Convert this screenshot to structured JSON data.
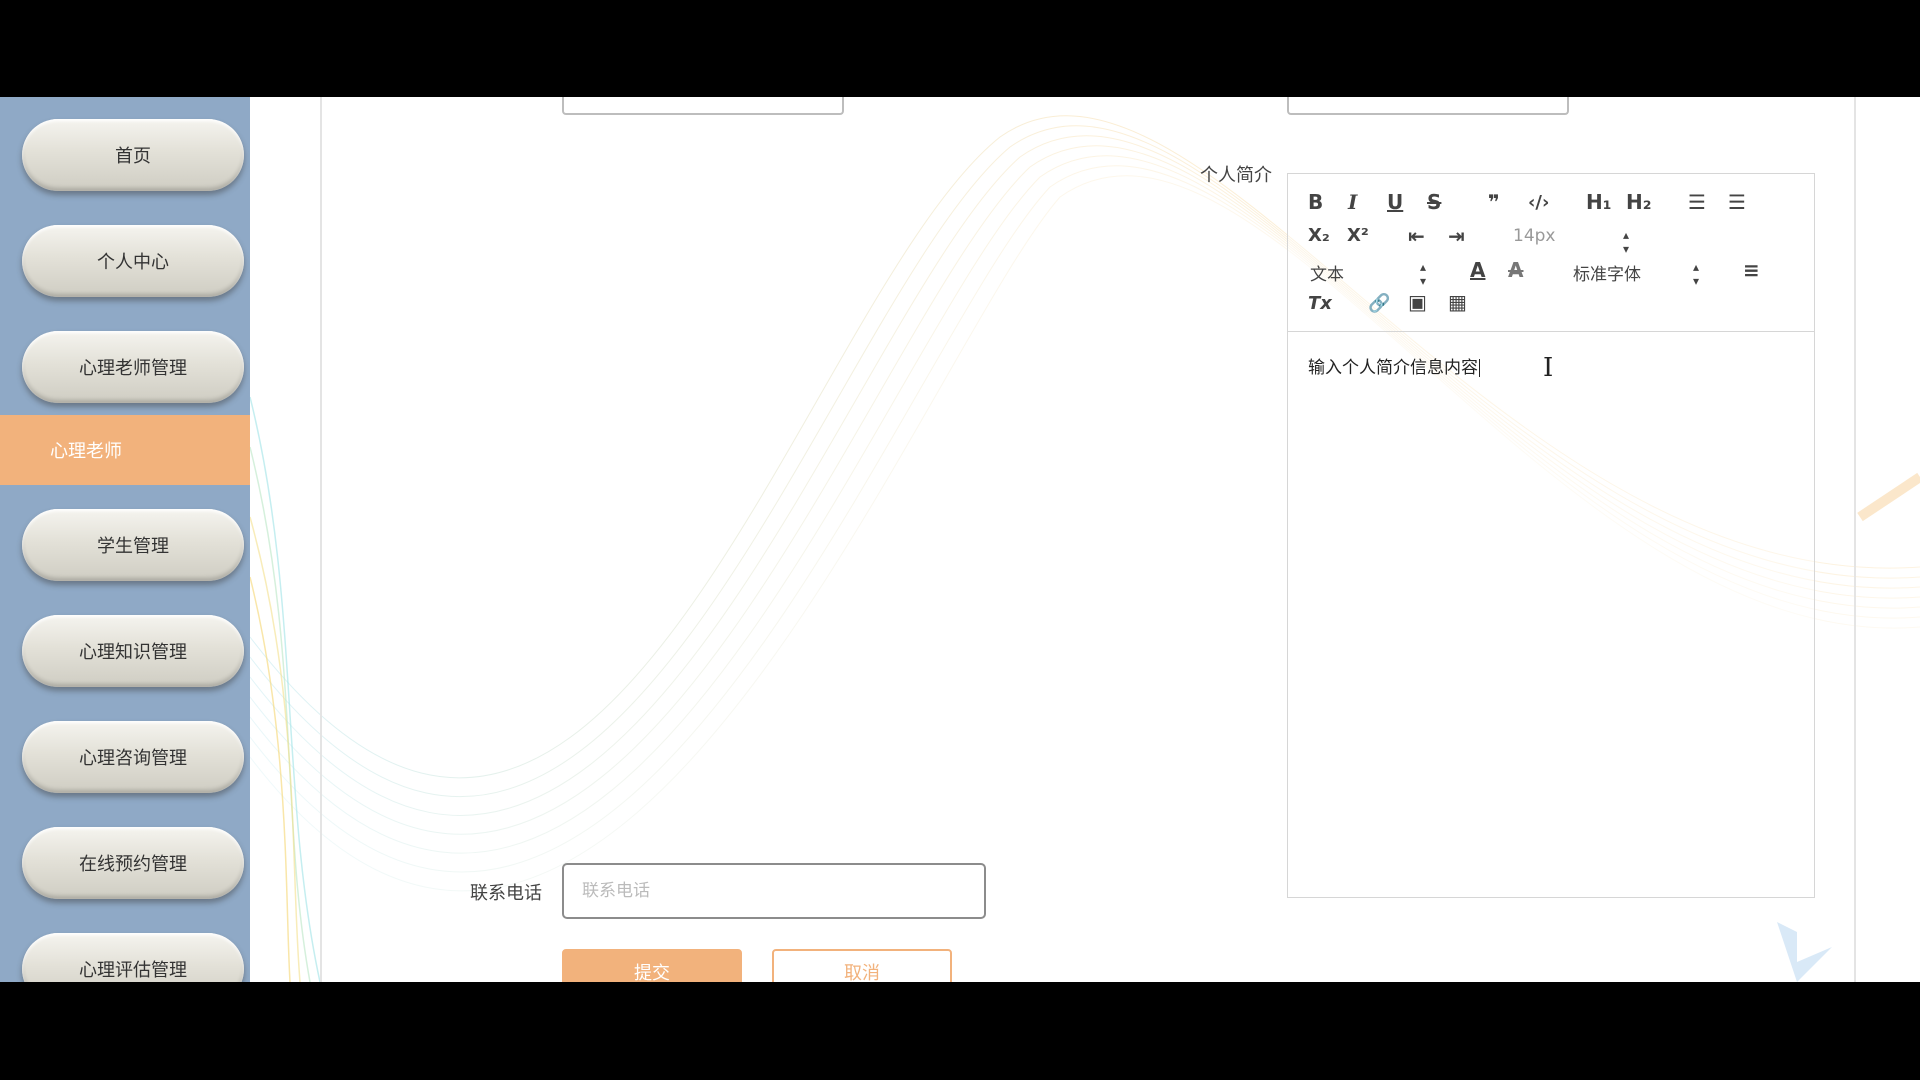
{
  "sidebar": {
    "items": [
      {
        "label": "首页"
      },
      {
        "label": "个人中心"
      },
      {
        "label": "心理老师管理"
      },
      {
        "label": "学生管理"
      },
      {
        "label": "心理知识管理"
      },
      {
        "label": "心理咨询管理"
      },
      {
        "label": "在线预约管理"
      },
      {
        "label": "心理评估管理"
      }
    ],
    "active_sub_item": "心理老师"
  },
  "form": {
    "bio_label": "个人简介",
    "phone_label": "联系电话",
    "phone_placeholder": "联系电话",
    "submit_label": "提交",
    "cancel_label": "取消"
  },
  "editor": {
    "toolbar": {
      "bold": "B",
      "italic": "I",
      "underline": "U",
      "strike": "S",
      "blockquote": "❞",
      "code": "‹/›",
      "h1": "H₁",
      "h2": "H₂",
      "ordered_list": "☰",
      "bullet_list": "☰",
      "subscript": "X₂",
      "superscript": "X²",
      "outdent": "⇤",
      "indent": "⇥",
      "font_size": "14px",
      "header_select": "文本",
      "font_family": "标准字体",
      "color": "A",
      "background": "A",
      "align": "≡",
      "clean": "Tx",
      "link": "🔗",
      "image": "▣",
      "video": "▦"
    },
    "content": "输入个人简介信息内容"
  },
  "colors": {
    "sidebar_bg": "#8fa9c6",
    "accent": "#f2b27c"
  }
}
